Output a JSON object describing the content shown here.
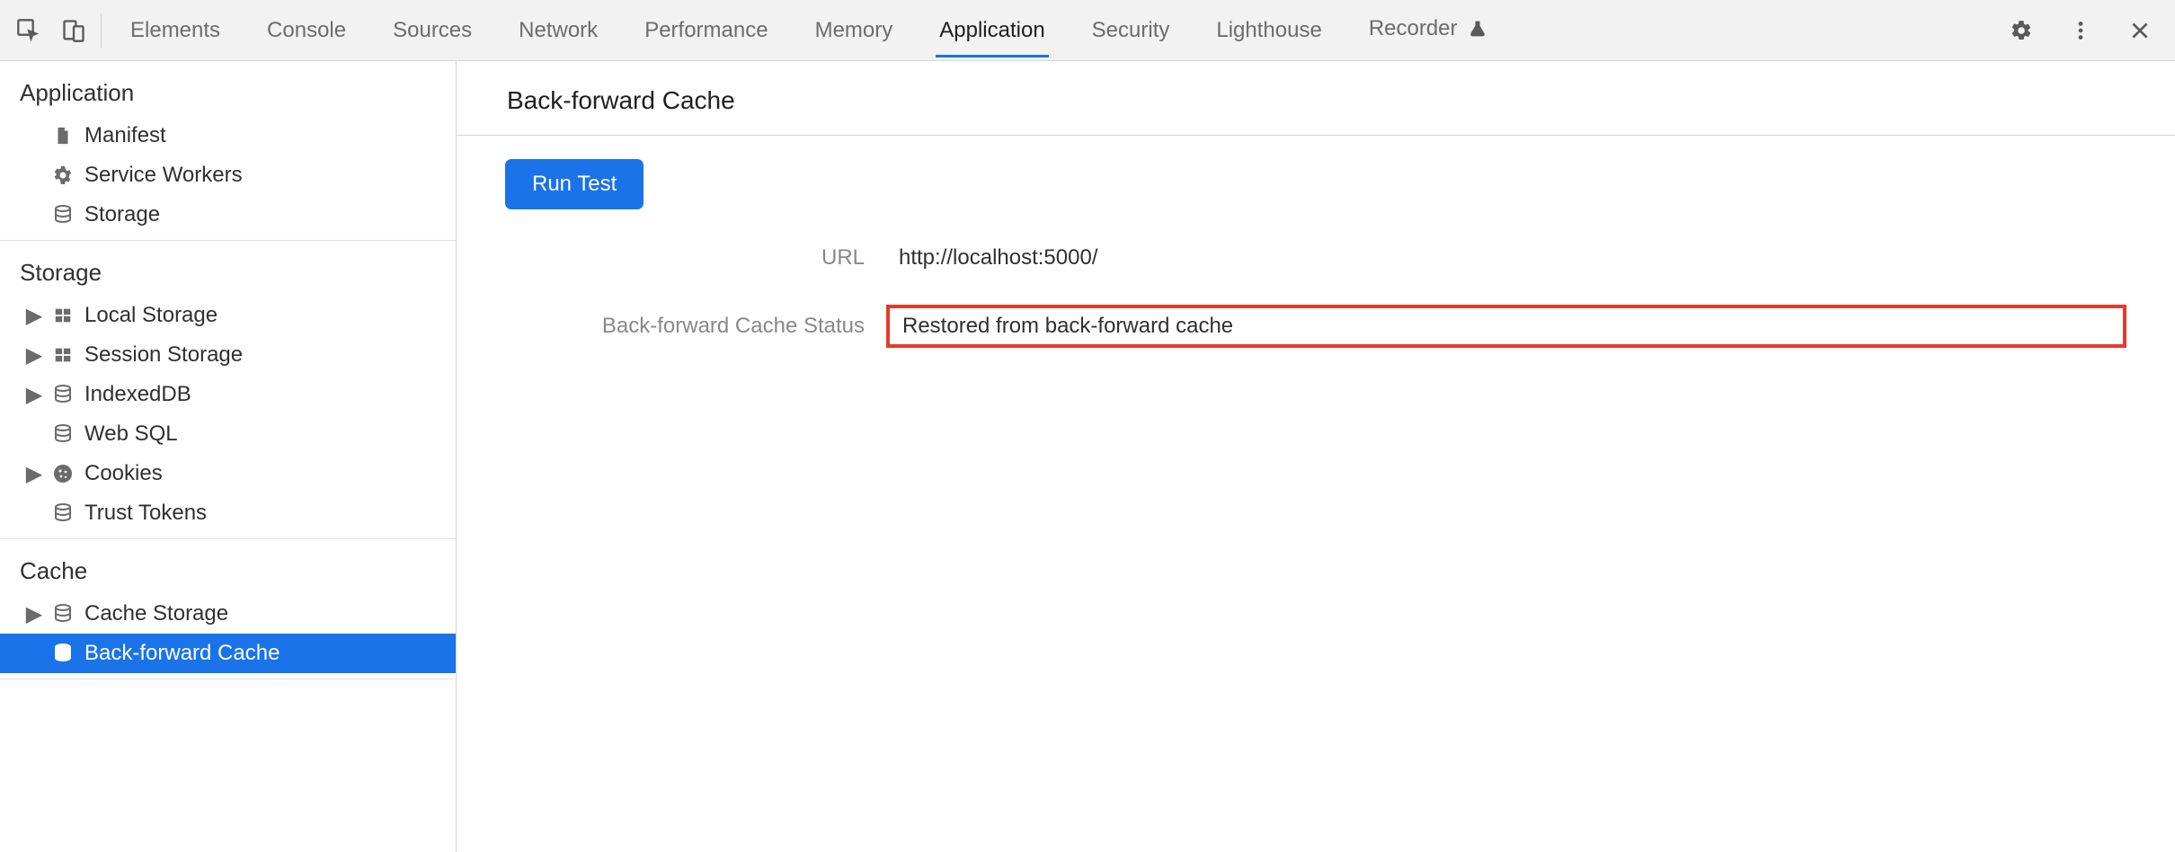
{
  "toolbar": {
    "tabs": [
      {
        "id": "elements",
        "label": "Elements",
        "active": false
      },
      {
        "id": "console",
        "label": "Console",
        "active": false
      },
      {
        "id": "sources",
        "label": "Sources",
        "active": false
      },
      {
        "id": "network",
        "label": "Network",
        "active": false
      },
      {
        "id": "performance",
        "label": "Performance",
        "active": false
      },
      {
        "id": "memory",
        "label": "Memory",
        "active": false
      },
      {
        "id": "application",
        "label": "Application",
        "active": true
      },
      {
        "id": "security",
        "label": "Security",
        "active": false
      },
      {
        "id": "lighthouse",
        "label": "Lighthouse",
        "active": false
      },
      {
        "id": "recorder",
        "label": "Recorder",
        "active": false,
        "experimental": true
      }
    ]
  },
  "sidebar": {
    "groups": [
      {
        "title": "Application",
        "items": [
          {
            "id": "manifest",
            "label": "Manifest",
            "icon": "file-icon",
            "expandable": false
          },
          {
            "id": "service-workers",
            "label": "Service Workers",
            "icon": "gear-icon",
            "expandable": false
          },
          {
            "id": "storage",
            "label": "Storage",
            "icon": "db-icon",
            "expandable": false
          }
        ]
      },
      {
        "title": "Storage",
        "items": [
          {
            "id": "local-storage",
            "label": "Local Storage",
            "icon": "table-icon",
            "expandable": true
          },
          {
            "id": "session-storage",
            "label": "Session Storage",
            "icon": "table-icon",
            "expandable": true
          },
          {
            "id": "indexeddb",
            "label": "IndexedDB",
            "icon": "db-icon",
            "expandable": true
          },
          {
            "id": "web-sql",
            "label": "Web SQL",
            "icon": "db-icon",
            "expandable": false
          },
          {
            "id": "cookies",
            "label": "Cookies",
            "icon": "cookie-icon",
            "expandable": true
          },
          {
            "id": "trust-tokens",
            "label": "Trust Tokens",
            "icon": "db-icon",
            "expandable": false
          }
        ]
      },
      {
        "title": "Cache",
        "items": [
          {
            "id": "cache-storage",
            "label": "Cache Storage",
            "icon": "db-icon",
            "expandable": true
          },
          {
            "id": "back-forward-cache",
            "label": "Back-forward Cache",
            "icon": "db-icon",
            "expandable": false,
            "selected": true
          }
        ]
      }
    ]
  },
  "content": {
    "title": "Back-forward Cache",
    "run_button_label": "Run Test",
    "rows": [
      {
        "label": "URL",
        "value": "http://localhost:5000/",
        "highlight": false
      },
      {
        "label": "Back-forward Cache Status",
        "value": "Restored from back-forward cache",
        "highlight": true
      }
    ]
  }
}
